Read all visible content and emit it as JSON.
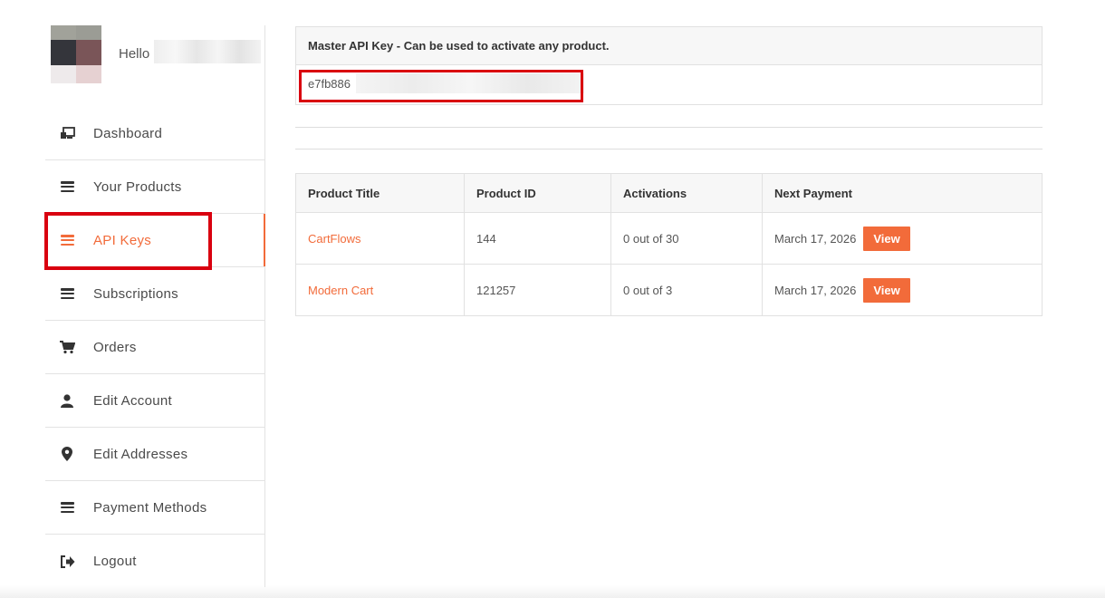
{
  "user": {
    "greeting": "Hello",
    "avatar_colors": [
      "#a1a29a",
      "#9b9c95",
      "#34353b",
      "#7a5558",
      "#eeeaeb",
      "#e6d1d2"
    ]
  },
  "sidebar": {
    "items": [
      {
        "label": "Dashboard",
        "icon": "dashboard-icon",
        "active": false
      },
      {
        "label": "Your Products",
        "icon": "list-icon",
        "active": false
      },
      {
        "label": "API Keys",
        "icon": "list-icon",
        "active": true
      },
      {
        "label": "Subscriptions",
        "icon": "list-icon",
        "active": false
      },
      {
        "label": "Orders",
        "icon": "cart-icon",
        "active": false
      },
      {
        "label": "Edit Account",
        "icon": "user-icon",
        "active": false
      },
      {
        "label": "Edit Addresses",
        "icon": "map-pin-icon",
        "active": false
      },
      {
        "label": "Payment Methods",
        "icon": "list-icon",
        "active": false
      },
      {
        "label": "Logout",
        "icon": "logout-icon",
        "active": false
      }
    ]
  },
  "master_key": {
    "heading": "Master API Key - Can be used to activate any product.",
    "value_prefix": "e7fb886"
  },
  "table": {
    "headers": [
      "Product Title",
      "Product ID",
      "Activations",
      "Next Payment"
    ],
    "rows": [
      {
        "title": "CartFlows",
        "id": "144",
        "activations": "0 out of 30",
        "next_payment": "March 17, 2026",
        "action": "View"
      },
      {
        "title": "Modern Cart",
        "id": "121257",
        "activations": "0 out of 3",
        "next_payment": "March 17, 2026",
        "action": "View"
      }
    ]
  },
  "colors": {
    "accent": "#f26b3a",
    "highlight_box": "#d9000f"
  }
}
